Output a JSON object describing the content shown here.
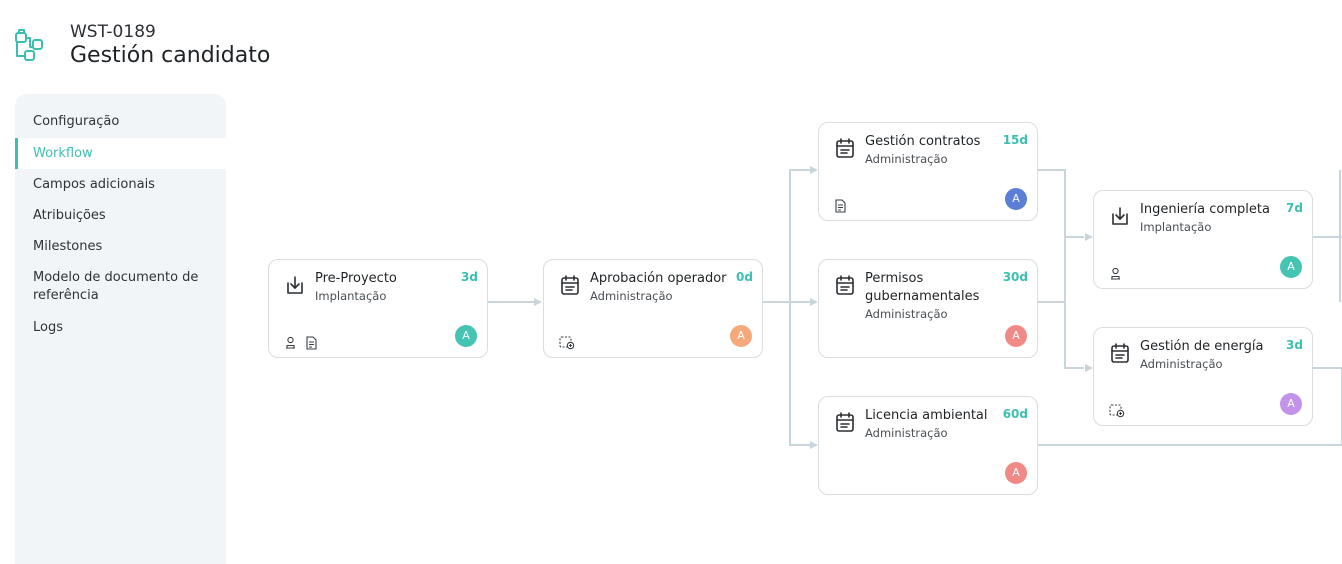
{
  "header": {
    "code": "WST-0189",
    "title": "Gestión candidato"
  },
  "sidebar": {
    "items": [
      {
        "label": "Configuração"
      },
      {
        "label": "Workflow",
        "active": true
      },
      {
        "label": "Campos adicionais"
      },
      {
        "label": "Atribuições"
      },
      {
        "label": "Milestones"
      },
      {
        "label": "Modelo de documento de referência"
      },
      {
        "label": "Logs"
      }
    ]
  },
  "workflow": {
    "nodes": [
      {
        "title": "Pre-Proyecto",
        "subtitle": "Implantação",
        "days": "3d",
        "icon": "download-icon",
        "avatar": "A",
        "avatar_color": "#45c4b4",
        "footer_icons": [
          "user-stamp-icon",
          "document-icon"
        ]
      },
      {
        "title": "Aprobación operador",
        "subtitle": "Administração",
        "days": "0d",
        "icon": "calendar-icon",
        "avatar": "A",
        "avatar_color": "#f5a97a",
        "footer_icons": [
          "add-frame-icon"
        ]
      },
      {
        "title": "Gestión contratos",
        "subtitle": "Administração",
        "days": "15d",
        "icon": "calendar-icon",
        "avatar": "A",
        "avatar_color": "#5b7fd6",
        "footer_icons": [
          "document-icon"
        ]
      },
      {
        "title": "Permisos gubernamentales",
        "subtitle": "Administração",
        "days": "30d",
        "icon": "calendar-icon",
        "avatar": "A",
        "avatar_color": "#f08a86",
        "footer_icons": []
      },
      {
        "title": "Licencia ambiental",
        "subtitle": "Administração",
        "days": "60d",
        "icon": "calendar-icon",
        "avatar": "A",
        "avatar_color": "#f08a86",
        "footer_icons": []
      },
      {
        "title": "Ingeniería completa",
        "subtitle": "Implantação",
        "days": "7d",
        "icon": "download-icon",
        "avatar": "A",
        "avatar_color": "#45c4b4",
        "footer_icons": [
          "user-stamp-icon"
        ]
      },
      {
        "title": "Gestión de energía",
        "subtitle": "Administração",
        "days": "3d",
        "icon": "calendar-icon",
        "avatar": "A",
        "avatar_color": "#c392ea",
        "footer_icons": [
          "add-frame-icon"
        ]
      }
    ]
  },
  "colors": {
    "accent": "#3dbfb0",
    "connector": "#c9d5da",
    "sidebar_bg": "#f1f5f7"
  }
}
